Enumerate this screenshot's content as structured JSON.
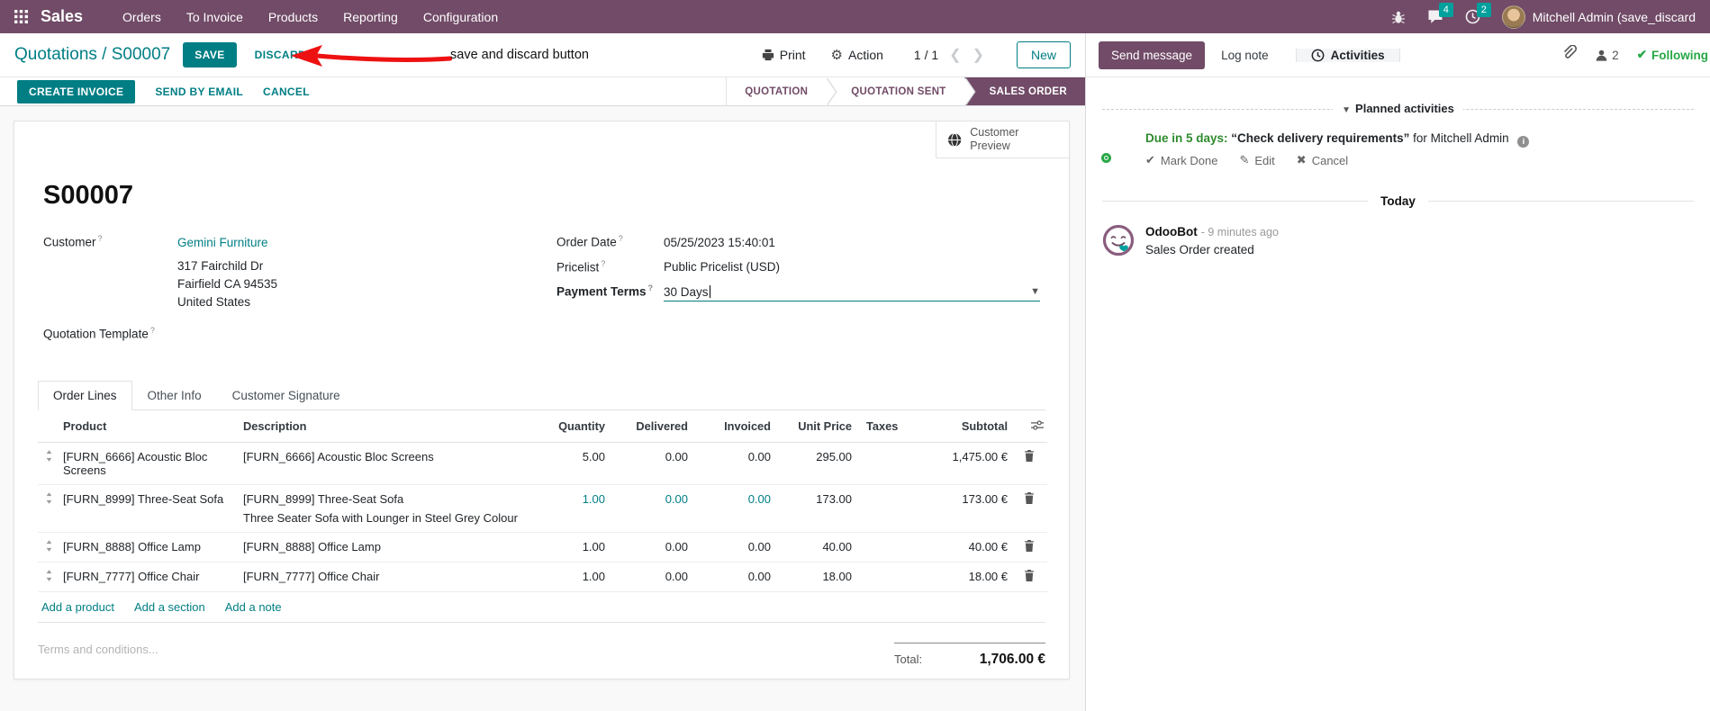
{
  "navbar": {
    "app_name": "Sales",
    "menus": [
      "Orders",
      "To Invoice",
      "Products",
      "Reporting",
      "Configuration"
    ],
    "messages_count": "4",
    "activities_count": "2",
    "user_name": "Mitchell Admin (save_discard",
    "colors": {
      "bg": "#714B67",
      "badge": "#00A09D",
      "primary": "#017E84"
    }
  },
  "control_panel": {
    "breadcrumb": "Quotations / S00007",
    "save_label": "SAVE",
    "discard_label": "DISCARD",
    "print_label": "Print",
    "action_label": "Action",
    "pager": "1 / 1",
    "new_label": "New"
  },
  "annotation": {
    "text": "save and discard button",
    "color": "#ee1111"
  },
  "statusbar": {
    "buttons": [
      "CREATE INVOICE",
      "SEND BY EMAIL",
      "CANCEL"
    ],
    "steps": [
      {
        "label": "QUOTATION",
        "active": false
      },
      {
        "label": "QUOTATION SENT",
        "active": false
      },
      {
        "label": "SALES ORDER",
        "active": true
      }
    ]
  },
  "form": {
    "customer_preview": "Customer Preview",
    "name": "S00007",
    "customer_label": "Customer",
    "customer": "Gemini Furniture",
    "address_lines": [
      "317 Fairchild Dr",
      "Fairfield CA 94535",
      "United States"
    ],
    "quotation_template_label": "Quotation Template",
    "order_date_label": "Order Date",
    "order_date": "05/25/2023 15:40:01",
    "pricelist_label": "Pricelist",
    "pricelist": "Public Pricelist (USD)",
    "payment_terms_label": "Payment Terms",
    "payment_terms": "30 Days",
    "tabs": [
      "Order Lines",
      "Other Info",
      "Customer Signature"
    ],
    "terms_placeholder": "Terms and conditions...",
    "total_label": "Total:",
    "total_value": "1,706.00 €"
  },
  "table": {
    "headers": [
      "Product",
      "Description",
      "Quantity",
      "Delivered",
      "Invoiced",
      "Unit Price",
      "Taxes",
      "Subtotal"
    ],
    "rows": [
      {
        "product": "[FURN_6666] Acoustic Bloc Screens",
        "desc": "[FURN_6666] Acoustic Bloc Screens",
        "desc2": "",
        "qty": "5.00",
        "delivered": "0.00",
        "invoiced": "0.00",
        "price": "295.00",
        "taxes": "",
        "subtotal": "1,475.00 €"
      },
      {
        "product": "[FURN_8999] Three-Seat Sofa",
        "desc": "[FURN_8999] Three-Seat Sofa",
        "desc2": "Three Seater Sofa with Lounger in Steel Grey Colour",
        "qty": "1.00",
        "delivered": "0.00",
        "invoiced": "0.00",
        "price": "173.00",
        "taxes": "",
        "subtotal": "173.00 €"
      },
      {
        "product": "[FURN_8888] Office Lamp",
        "desc": "[FURN_8888] Office Lamp",
        "desc2": "",
        "qty": "1.00",
        "delivered": "0.00",
        "invoiced": "0.00",
        "price": "40.00",
        "taxes": "",
        "subtotal": "40.00 €"
      },
      {
        "product": "[FURN_7777] Office Chair",
        "desc": "[FURN_7777] Office Chair",
        "desc2": "",
        "qty": "1.00",
        "delivered": "0.00",
        "invoiced": "0.00",
        "price": "18.00",
        "taxes": "",
        "subtotal": "18.00 €"
      }
    ],
    "add_links": [
      "Add a product",
      "Add a section",
      "Add a note"
    ]
  },
  "chatter": {
    "send_message": "Send message",
    "log_note": "Log note",
    "activities": "Activities",
    "followers_count": "2",
    "following": "Following",
    "planned_header": "Planned activities",
    "activity": {
      "due": "Due in 5 days:",
      "summary": "“Check delivery requirements”",
      "for_text": "for Mitchell Admin",
      "mark_done": "Mark Done",
      "edit": "Edit",
      "cancel": "Cancel"
    },
    "today": "Today",
    "message": {
      "author": "OdooBot",
      "time": "- 9 minutes ago",
      "body": "Sales Order created"
    }
  }
}
